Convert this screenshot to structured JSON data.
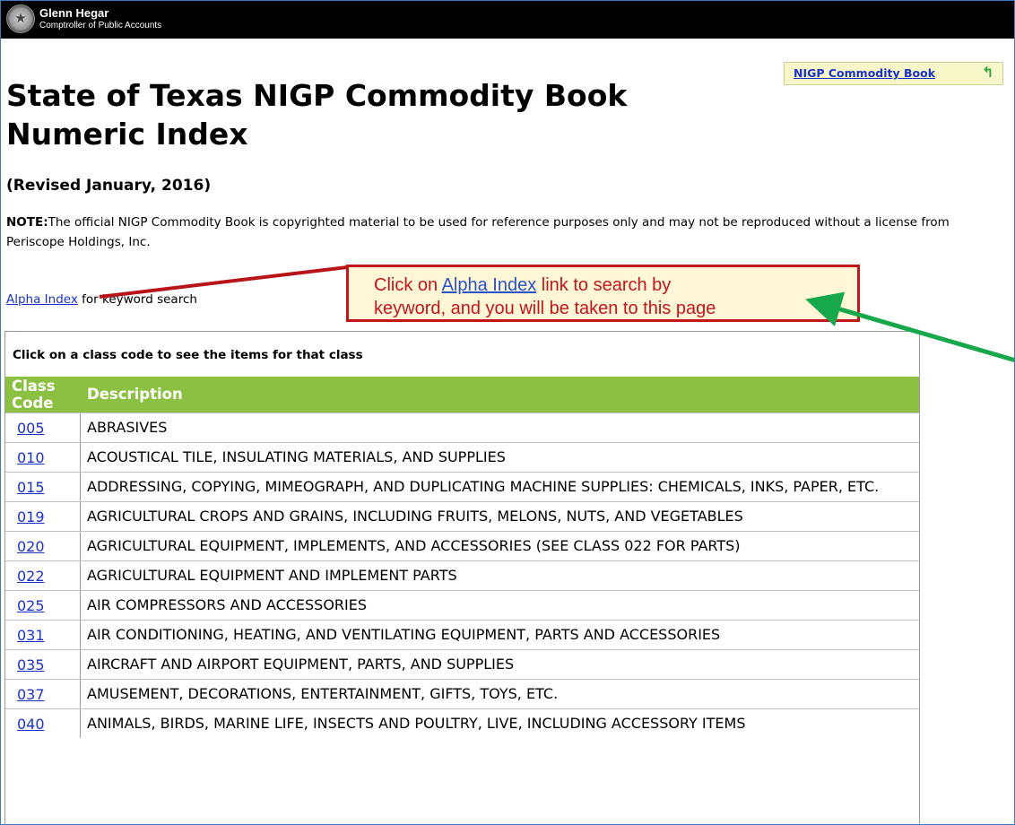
{
  "header": {
    "official_name": "Glenn Hegar",
    "official_title": "Comptroller of Public Accounts",
    "seal_icon": "texas-state-seal"
  },
  "nav": {
    "book_link": "NIGP Commodity Book",
    "book_link_icon": "return-arrow-icon"
  },
  "page": {
    "title_line1": "State of Texas NIGP Commodity Book",
    "title_line2": "Numeric Index",
    "revised": "(Revised January, 2016)",
    "note_label": "NOTE:",
    "note_text": "The official NIGP Commodity Book is copyrighted material to be used for reference purposes only and may not be reproduced without a license from Periscope Holdings, Inc.",
    "alpha_link": "Alpha Index",
    "alpha_suffix": " for keyword search"
  },
  "table": {
    "caption": "Click on a class code to see the items for that class",
    "header_code_line1": "Class",
    "header_code_line2": "Code",
    "header_description": "Description",
    "rows": [
      {
        "code": "005",
        "description": "ABRASIVES"
      },
      {
        "code": "010",
        "description": "ACOUSTICAL TILE, INSULATING MATERIALS, AND SUPPLIES"
      },
      {
        "code": "015",
        "description": "ADDRESSING, COPYING, MIMEOGRAPH, AND DUPLICATING MACHINE SUPPLIES: CHEMICALS, INKS, PAPER, ETC."
      },
      {
        "code": "019",
        "description": "AGRICULTURAL CROPS AND GRAINS, INCLUDING FRUITS, MELONS, NUTS, AND VEGETABLES"
      },
      {
        "code": "020",
        "description": "AGRICULTURAL EQUIPMENT, IMPLEMENTS, AND ACCESSORIES (SEE CLASS 022 FOR PARTS)"
      },
      {
        "code": "022",
        "description": "AGRICULTURAL EQUIPMENT AND IMPLEMENT PARTS"
      },
      {
        "code": "025",
        "description": "AIR COMPRESSORS AND ACCESSORIES"
      },
      {
        "code": "031",
        "description": "AIR CONDITIONING, HEATING, AND VENTILATING EQUIPMENT, PARTS AND ACCESSORIES"
      },
      {
        "code": "035",
        "description": "AIRCRAFT AND AIRPORT EQUIPMENT, PARTS, AND SUPPLIES"
      },
      {
        "code": "037",
        "description": "AMUSEMENT, DECORATIONS, ENTERTAINMENT, GIFTS, TOYS, ETC."
      },
      {
        "code": "040",
        "description": "ANIMALS, BIRDS, MARINE LIFE, INSECTS AND POULTRY, LIVE, INCLUDING ACCESSORY ITEMS"
      }
    ]
  },
  "callout": {
    "prefix": "Click on ",
    "link": "Alpha Index",
    "suffix": " link to search by",
    "line2": "keyword, and you will be taken to this page"
  },
  "colors": {
    "header_bar": "#000000",
    "table_header": "#8cc043",
    "link": "#1a32c8",
    "callout_border": "#c0161c",
    "callout_bg": "#fff7d6",
    "red_arrow": "#b81418",
    "green_arrow": "#16a84a"
  }
}
